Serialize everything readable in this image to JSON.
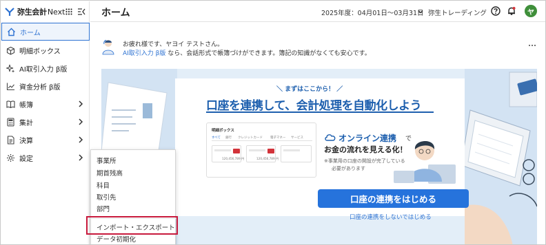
{
  "brand": {
    "name": "弥生会計",
    "name_sub": "Next"
  },
  "sidebar": {
    "items": [
      {
        "label": "ホーム",
        "icon": "home-icon"
      },
      {
        "label": "明細ボックス",
        "icon": "box-icon"
      },
      {
        "label": "AI取引入力 β版",
        "icon": "sparkle-icon"
      },
      {
        "label": "資金分析 β版",
        "icon": "chart-icon"
      },
      {
        "label": "帳簿",
        "icon": "book-icon"
      },
      {
        "label": "集計",
        "icon": "calculator-icon"
      },
      {
        "label": "決算",
        "icon": "document-icon"
      },
      {
        "label": "設定",
        "icon": "gear-icon"
      }
    ]
  },
  "header": {
    "title": "ホーム",
    "fiscal_year": "2025年度：04月01日～03月31日",
    "company": "弥生トレーディング",
    "avatar_initial": "ヤ"
  },
  "greeting": {
    "line1": "お疲れ様です、ヤヨイ テストさん。",
    "link": "AI取引入力 β版",
    "line2_rest": "なら、会話形式で帳簿づけができます。簿記の知識がなくても安心です。"
  },
  "banner": {
    "tagline": "＼ まずはここから！ ／",
    "headline": "口座を連携して、会計処理を自動化しよう",
    "mini_title": "明細ボックス",
    "mini_tabs": [
      "すべて",
      "銀行",
      "クレジットカード",
      "電子マネー",
      "サービス"
    ],
    "mini_amount": "120,456,789 円",
    "online": "オンライン連携",
    "online_suffix": "で",
    "flow": "お金の流れを見える化！",
    "note1": "※事業用の口座の開設が完了している",
    "note2": "必要があります",
    "cta": "口座の連携をはじめる",
    "cta_link": "口座の連携をしないではじめる"
  },
  "dropdown": {
    "items": [
      "事業所",
      "期首残高",
      "科目",
      "取引先",
      "部門",
      "インポート・エクスポート",
      "データ初期化"
    ]
  },
  "colors": {
    "accent": "#2d72d2",
    "banner_bg": "#e3eef8",
    "highlight": "#c8193c",
    "avatar": "#3f8f3a"
  }
}
